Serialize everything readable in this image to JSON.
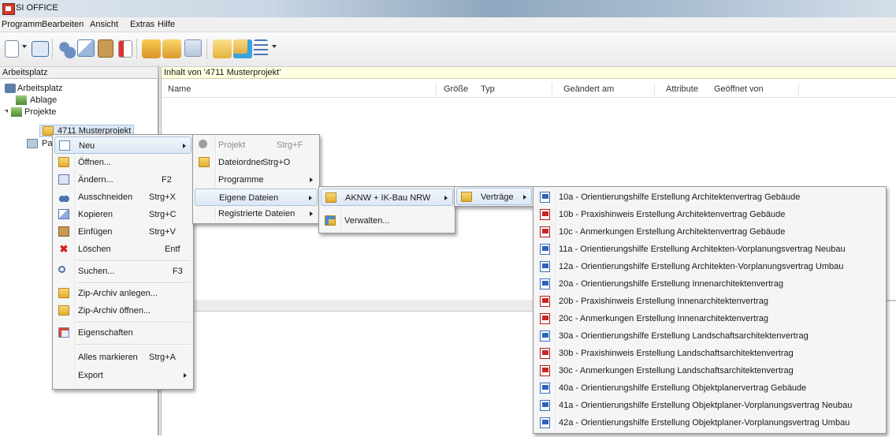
{
  "window": {
    "title": "SI OFFICE"
  },
  "menubar": [
    "Programm",
    "Bearbeiten",
    "Ansicht",
    "Extras",
    "Hilfe"
  ],
  "left_panel": {
    "header": "Arbeitsplatz",
    "tree": [
      "Arbeitsplatz",
      "Ablage",
      "Projekte",
      "4711 Musterprojekt",
      "Pa"
    ]
  },
  "right_panel": {
    "header": "Inhalt von '4711 Musterprojekt'",
    "columns": [
      "Name",
      "Größe",
      "Typ",
      "Geändert am",
      "Attribute",
      "Geöffnet von"
    ]
  },
  "context_menu": [
    {
      "label": "Neu",
      "shortcut": "",
      "submenu": true,
      "icon": "new-icon"
    },
    {
      "label": "Öffnen...",
      "shortcut": "",
      "icon": "open-folder-icon"
    },
    {
      "label": "Ändern...",
      "shortcut": "F2",
      "icon": "edit-icon"
    },
    {
      "label": "Ausschneiden",
      "shortcut": "Strg+X",
      "icon": "scissors-icon"
    },
    {
      "label": "Kopieren",
      "shortcut": "Strg+C",
      "icon": "copy-icon"
    },
    {
      "label": "Einfügen",
      "shortcut": "Strg+V",
      "icon": "paste-icon"
    },
    {
      "label": "Löschen",
      "shortcut": "Entf",
      "icon": "delete-icon"
    },
    {
      "label": "Suchen...",
      "shortcut": "F3",
      "icon": "search-icon"
    },
    {
      "label": "Zip-Archiv anlegen...",
      "shortcut": "",
      "icon": "zip-create-icon"
    },
    {
      "label": "Zip-Archiv öffnen...",
      "shortcut": "",
      "icon": "zip-open-icon"
    },
    {
      "label": "Eigenschaften",
      "shortcut": "",
      "icon": "properties-icon"
    },
    {
      "label": "Alles markieren",
      "shortcut": "Strg+A",
      "icon": ""
    },
    {
      "label": "Export",
      "shortcut": "",
      "submenu": true,
      "icon": ""
    }
  ],
  "new_submenu": [
    {
      "label": "Projekt",
      "shortcut": "Strg+F",
      "disabled": true
    },
    {
      "label": "Dateiordner",
      "shortcut": "Strg+O"
    },
    {
      "label": "Programme",
      "submenu": true
    },
    {
      "label": "Eigene Dateien",
      "submenu": true
    },
    {
      "label": "Registrierte Dateien",
      "submenu": true
    }
  ],
  "eigene_submenu": [
    {
      "label": "AKNW + IK-Bau NRW",
      "submenu": true
    },
    {
      "label": "Verwalten..."
    }
  ],
  "aknw_submenu": [
    {
      "label": "Verträge",
      "submenu": true
    }
  ],
  "vertraege_submenu": [
    {
      "label": "10a - Orientierungshilfe Erstellung Architektenvertrag Gebäude",
      "kind": "doc"
    },
    {
      "label": "10b - Praxishinweis Erstellung Architektenvertrag Gebäude",
      "kind": "pdf"
    },
    {
      "label": "10c - Anmerkungen Erstellung Architektenvertrag Gebäude",
      "kind": "pdf"
    },
    {
      "label": "11a - Orientierungshilfe Erstellung Architekten-Vorplanungsvertrag Neubau",
      "kind": "doc"
    },
    {
      "label": "12a - Orientierungshilfe Erstellung Architekten-Vorplanungsvertrag Umbau",
      "kind": "doc"
    },
    {
      "label": "20a - Orientierungshilfe Erstellung Innenarchitektenvertrag",
      "kind": "doc"
    },
    {
      "label": "20b - Praxishinweis Erstellung Innenarchitektenvertrag",
      "kind": "pdf"
    },
    {
      "label": "20c - Anmerkungen Erstellung Innenarchitektenvertrag",
      "kind": "pdf"
    },
    {
      "label": "30a - Orientierungshilfe Erstellung Landschaftsarchitektenvertrag",
      "kind": "doc"
    },
    {
      "label": "30b - Praxishinweis Erstellung Landschaftsarchitektenvertrag",
      "kind": "pdf"
    },
    {
      "label": "30c - Anmerkungen Erstellung Landschaftsarchitektenvertrag",
      "kind": "pdf"
    },
    {
      "label": "40a - Orientierungshilfe Erstellung Objektplanervertrag Gebäude",
      "kind": "doc"
    },
    {
      "label": "41a - Orientierungshilfe Erstellung Objektplaner-Vorplanungsvertrag Neubau",
      "kind": "doc"
    },
    {
      "label": "42a - Orientierungshilfe Erstellung Objektplaner-Vorplanungsvertrag Umbau",
      "kind": "doc"
    }
  ]
}
